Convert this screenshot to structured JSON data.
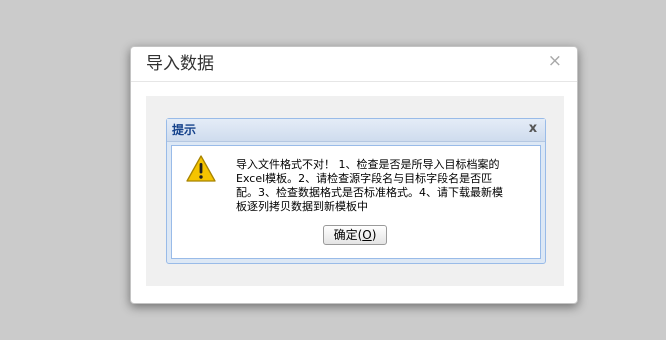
{
  "outer_dialog": {
    "title": "导入数据",
    "close_glyph": "×"
  },
  "alert": {
    "title": "提示",
    "close_glyph": "x",
    "icon": "warning-icon",
    "message": "导入文件格式不对！ 1、检查是否是所导入目标档案的\nExcel模板。2、请检查源字段名与目标字段名是否匹\n配。3、检查数据格式是否标准格式。4、请下载最新模\n板逐列拷贝数据到新模板中",
    "ok_button": {
      "label": "确定(",
      "mnemonic": "O",
      "suffix": ")"
    }
  },
  "colors": {
    "backdrop": "#cbcbcb",
    "alert_header": "#cfdcee",
    "alert_title": "#15428b",
    "warning": "#f5c400"
  }
}
